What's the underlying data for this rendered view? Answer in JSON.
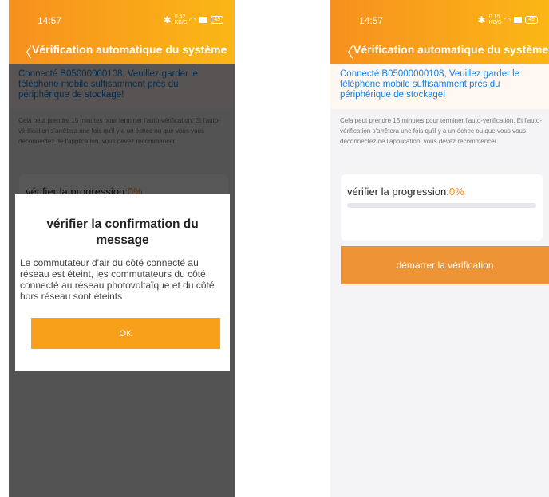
{
  "status_bar": {
    "time": "14:57",
    "left_network": "0.42 KB/S",
    "right_network": "0.15 KB/S",
    "battery": "49"
  },
  "header": {
    "title": "Vérification automatique du système"
  },
  "notice": {
    "text": "Connecté B05000000108, Veuillez garder le téléphone mobile suffisamment près du périphérique de stockage!"
  },
  "info": {
    "text": "Cela peut prendre 15 minutes pour terminer l'auto-vérification. Et l'auto-vérification s'arrêtera une fois qu'il y a un échec ou que vous vous déconnectez de l'application, vous devez recommencer."
  },
  "progress_card": {
    "label": "vérifier la progression:",
    "percent": "0%",
    "progress_value": 0
  },
  "start_button": {
    "label": "démarrer la vérification"
  },
  "dialog": {
    "title": "vérifier la confirmation du message",
    "message": "Le commutateur d'air du côté connecté au réseau est éteint, les commutateurs du côté connecté au réseau photovoltaïque et du côté hors réseau sont éteints",
    "ok_label": "OK"
  },
  "colors": {
    "header_gradient_start": "#f7901e",
    "header_gradient_end": "#fbb715",
    "notice_text": "#1583e6",
    "accent": "#f7901e",
    "start_button": "#ec9436",
    "ok_button": "#f9a01b"
  },
  "icons": {
    "back": "chevron-left-icon",
    "bluetooth": "bluetooth-icon",
    "wifi": "wifi-icon",
    "sim": "sim-icon",
    "battery": "battery-icon"
  }
}
